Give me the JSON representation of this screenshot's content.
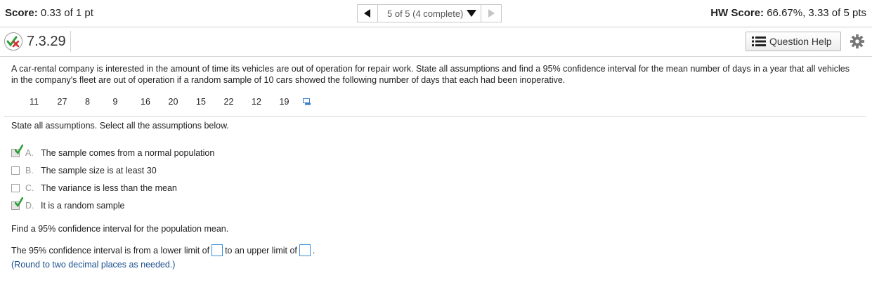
{
  "header": {
    "score_label": "Score:",
    "score_value": "0.33 of 1 pt",
    "nav_status": "5 of 5 (4 complete)",
    "hw_score_label": "HW Score:",
    "hw_score_value": "66.67%, 3.33 of 5 pts"
  },
  "question": {
    "id": "7.3.29",
    "help_label": "Question Help",
    "prompt": "A car-rental company is interested in the amount of time its vehicles are out of operation for repair work. State all assumptions and find a 95% confidence interval for the mean number of days in a year that all vehicles in the company's fleet are out of operation if a random sample of 10 cars showed the following number of days that each had been inoperative.",
    "data_values": [
      "11",
      "27",
      "8",
      "9",
      "16",
      "20",
      "15",
      "22",
      "12",
      "19"
    ],
    "instruction": "State all assumptions. Select all the assumptions below.",
    "options": [
      {
        "letter": "A.",
        "text": "The sample comes from a normal population",
        "checked": true
      },
      {
        "letter": "B.",
        "text": "The sample size is at least 30",
        "checked": false
      },
      {
        "letter": "C.",
        "text": "The variance is less than the mean",
        "checked": false
      },
      {
        "letter": "D.",
        "text": "It is a random sample",
        "checked": true
      }
    ],
    "find_prompt": "Find a 95% confidence interval for the population mean.",
    "answer_pre": "The 95% confidence interval is from a lower limit of",
    "answer_mid": "to an upper limit of",
    "answer_end": ".",
    "round_note": "(Round to two decimal places as needed.)"
  },
  "colors": {
    "check_green": "#2e9e3a",
    "x_red": "#d0312d",
    "input_border": "#3b8fd9",
    "note_blue": "#1b4f8e"
  }
}
